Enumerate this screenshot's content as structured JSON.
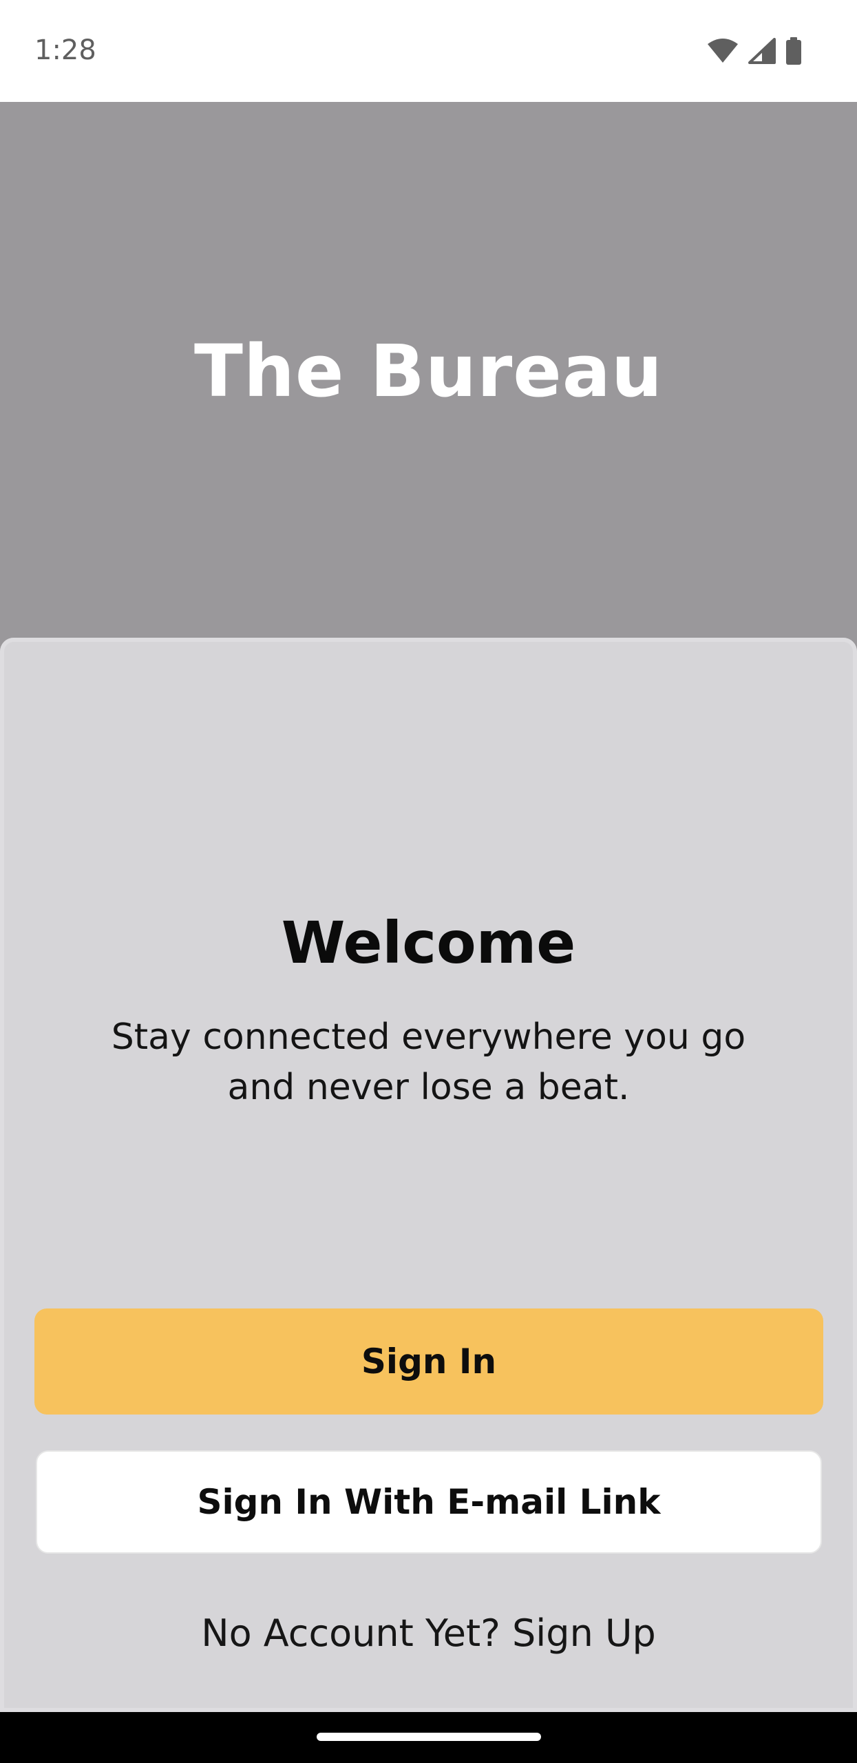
{
  "status_bar": {
    "time": "1:28",
    "icons": [
      "wifi-icon",
      "cellular-signal-icon",
      "battery-icon"
    ]
  },
  "hero": {
    "app_title": "The Bureau"
  },
  "sheet": {
    "heading": "Welcome",
    "subtitle": "Stay connected everywhere you go and never lose a beat.",
    "sign_in_label": "Sign In",
    "email_link_label": "Sign In With E-mail Link",
    "signup_text": "No Account Yet? Sign Up"
  },
  "colors": {
    "hero_background": "#9a989b",
    "sheet_background": "#d6d5d8",
    "primary_button": "#f7c25d",
    "secondary_button": "#ffffff"
  }
}
